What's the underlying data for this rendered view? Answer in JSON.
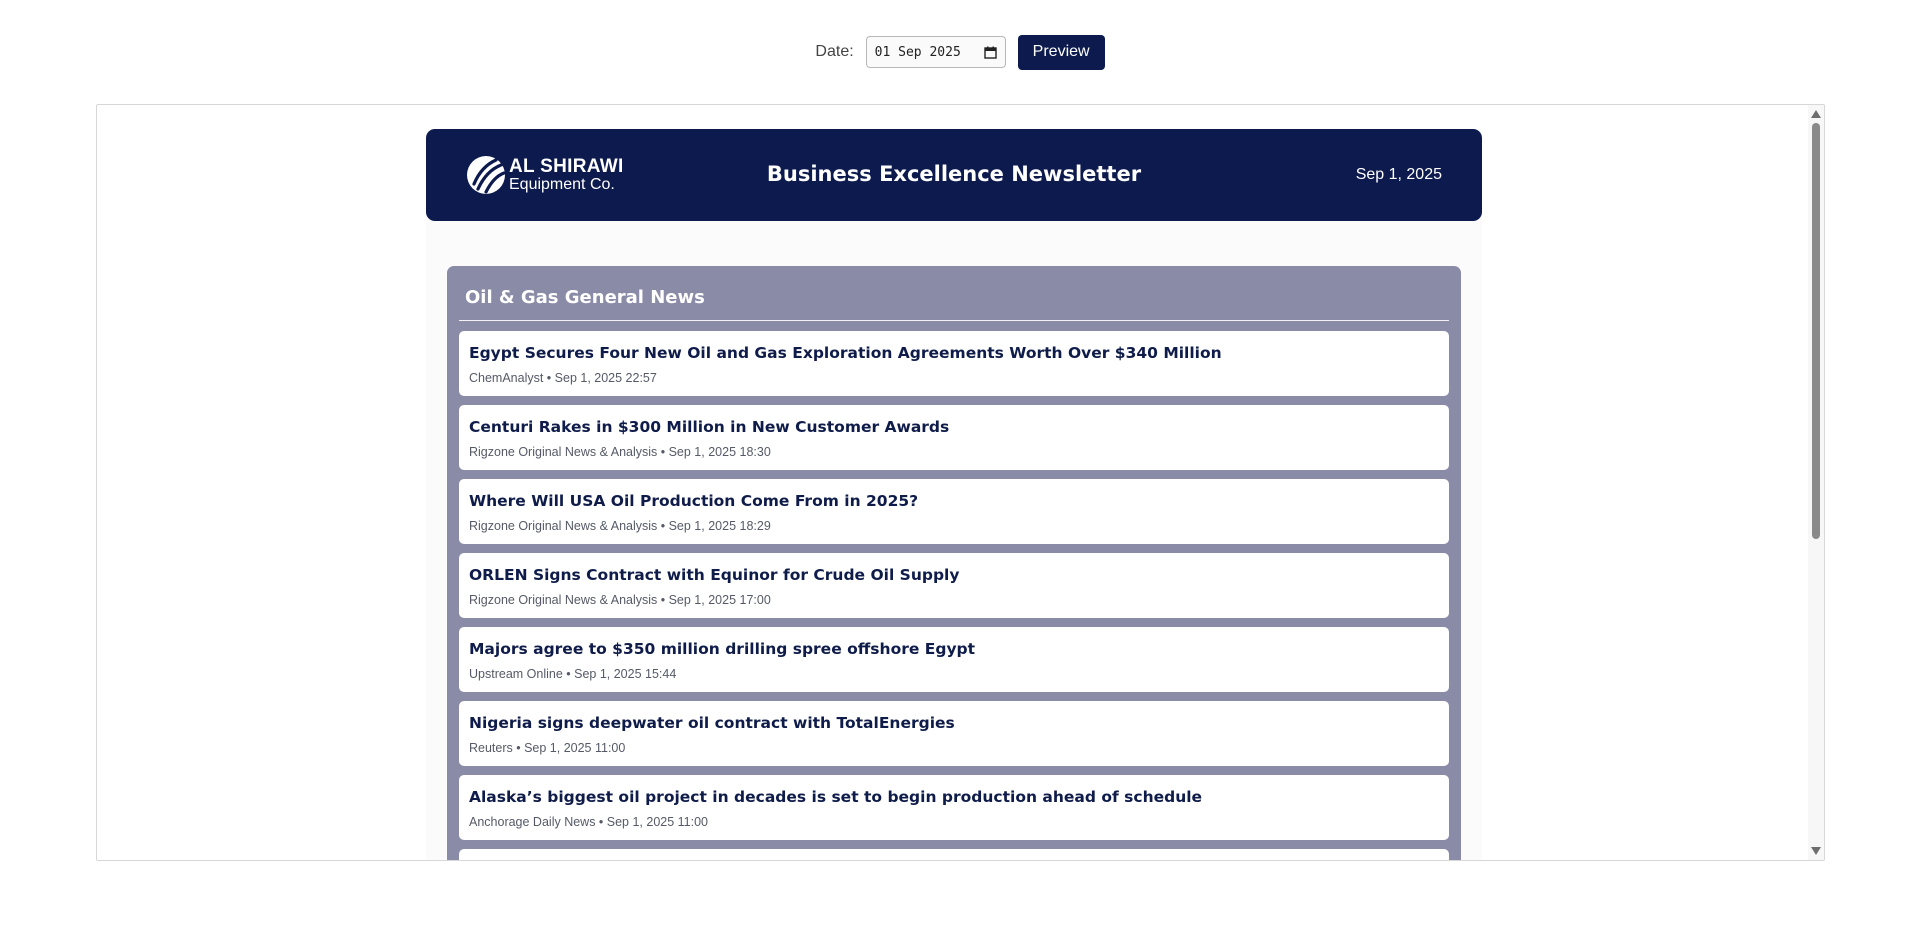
{
  "controls": {
    "date_label": "Date:",
    "date_value": "01 Sep 2025",
    "preview_label": "Preview",
    "calendar_icon": "calendar-icon"
  },
  "newsletter": {
    "logo": {
      "line1": "AL SHIRAWI",
      "line2": "Equipment Co."
    },
    "title": "Business Excellence Newsletter",
    "date": "Sep 1, 2025",
    "colors": {
      "header_bg": "#0c1a4d",
      "section_bg": "#8a8ba6",
      "button_bg": "#0c1a4d"
    },
    "section": {
      "title": "Oil & Gas General News",
      "items": [
        {
          "title": "Egypt Secures Four New Oil and Gas Exploration Agreements Worth Over $340 Million",
          "meta": "ChemAnalyst • Sep 1, 2025 22:57"
        },
        {
          "title": "Centuri Rakes in $300 Million in New Customer Awards",
          "meta": "Rigzone Original News & Analysis • Sep 1, 2025 18:30"
        },
        {
          "title": "Where Will USA Oil Production Come From in 2025?",
          "meta": "Rigzone Original News & Analysis • Sep 1, 2025 18:29"
        },
        {
          "title": "ORLEN Signs Contract with Equinor for Crude Oil Supply",
          "meta": "Rigzone Original News & Analysis • Sep 1, 2025 17:00"
        },
        {
          "title": "Majors agree to $350 million drilling spree offshore Egypt",
          "meta": "Upstream Online • Sep 1, 2025 15:44"
        },
        {
          "title": "Nigeria signs deepwater oil contract with TotalEnergies",
          "meta": "Reuters • Sep 1, 2025 11:00"
        },
        {
          "title": "Alaska’s biggest oil project in decades is set to begin production ahead of schedule",
          "meta": "Anchorage Daily News • Sep 1, 2025 11:00"
        },
        {
          "title": "",
          "meta": ""
        }
      ]
    }
  }
}
